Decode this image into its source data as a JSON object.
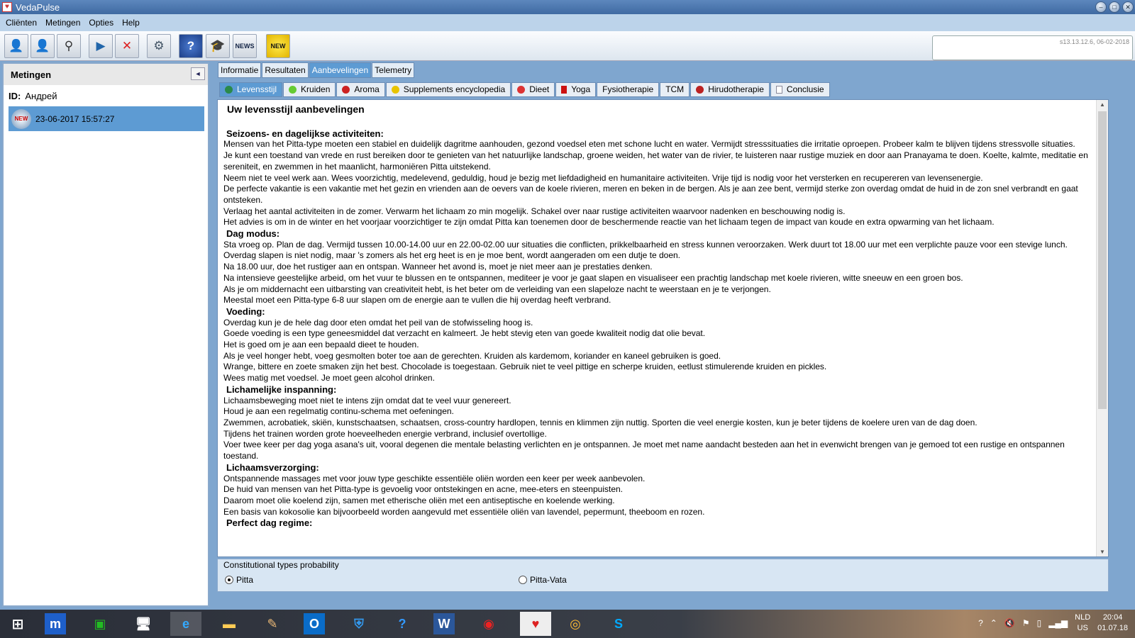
{
  "window": {
    "title": "VedaPulse"
  },
  "menu": [
    "Cliënten",
    "Metingen",
    "Opties",
    "Help"
  ],
  "toolbar": {
    "version": "s13.13.12.6, 06-02-2018",
    "icons": [
      "add-client-icon",
      "remove-client-icon",
      "search-client-icon",
      "start-measurement-icon",
      "delete-measurement-icon",
      "settings-icon",
      "help-icon",
      "education-icon",
      "news-icon",
      "new-version-icon"
    ],
    "news_label": "NEWS",
    "new_label": "NEW"
  },
  "left_panel": {
    "title": "Metingen",
    "id_label": "ID:",
    "id_value": "Андрей",
    "new_badge": "NEW",
    "measurement": "23-06-2017 15:57:27"
  },
  "tabs": [
    "Informatie",
    "Resultaten",
    "Aanbevelingen",
    "Telemetry"
  ],
  "active_tab": "Aanbevelingen",
  "subtabs": [
    "Levensstijl",
    "Kruiden",
    "Aroma",
    "Supplements encyclopedia",
    "Dieet",
    "Yoga",
    "Fysiotherapie",
    "TCM",
    "Hirudotherapie",
    "Conclusie"
  ],
  "active_subtab": "Levensstijl",
  "content": {
    "title": "Uw levensstijl aanbevelingen",
    "sections": [
      {
        "heading": "Seizoens- en dagelijkse activiteiten:",
        "lines": [
          "Mensen van het Pitta-type moeten een stabiel en duidelijk dagritme aanhouden, gezond voedsel eten met schone lucht en water. Vermijdt stresssituaties die irritatie oproepen. Probeer kalm te blijven tijdens stressvolle situaties.",
          "Je kunt een toestand van vrede en rust bereiken door te genieten van het natuurlijke landschap, groene weiden, het water van de rivier, te luisteren naar rustige muziek en door aan Pranayama te doen. Koelte, kalmte, meditatie en sereniteit, en zwemmen in het maanlicht, harmoniëren Pitta uitstekend.",
          "Neem niet te veel werk aan. Wees voorzichtig, medelevend, geduldig, houd je bezig met liefdadigheid en humanitaire activiteiten. Vrije tijd is nodig voor het versterken en recupereren van levensenergie.",
          "De perfecte vakantie is een vakantie met het gezin en vrienden aan de oevers van de koele rivieren, meren en beken in de bergen. Als je aan zee bent, vermijd sterke zon overdag omdat de huid in de zon snel verbrandt en gaat ontsteken.",
          "Verlaag het aantal activiteiten in de zomer. Verwarm het lichaam zo min mogelijk. Schakel over naar rustige activiteiten waarvoor nadenken en beschouwing nodig is.",
          "Het advies is om in de winter en het voorjaar voorzichtiger te zijn omdat Pitta kan toenemen door de beschermende reactie van het lichaam tegen de impact van koude en extra opwarming van het lichaam."
        ]
      },
      {
        "heading": "Dag modus:",
        "lines": [
          "Sta vroeg op. Plan de dag. Vermijd tussen 10.00-14.00 uur en 22.00-02.00 uur situaties die conflicten, prikkelbaarheid en stress kunnen veroorzaken. Werk duurt tot 18.00 uur met een verplichte pauze voor een stevige lunch.",
          "Overdag slapen is niet nodig, maar 's zomers als het erg heet is en je moe bent, wordt aangeraden om een dutje te doen.",
          "Na 18.00 uur, doe het rustiger aan en ontspan. Wanneer het avond is, moet je niet meer aan je prestaties denken.",
          "Na intensieve geestelijke arbeid, om het vuur te blussen en te ontspannen, mediteer je voor je gaat slapen en visualiseer een prachtig landschap met koele rivieren, witte sneeuw en een groen bos.",
          "Als je om middernacht een uitbarsting van creativiteit hebt, is het beter om de verleiding van een slapeloze nacht te weerstaan en je te verjongen.",
          "Meestal moet een Pitta-type 6-8 uur slapen om de energie aan te vullen die hij overdag heeft verbrand."
        ]
      },
      {
        "heading": "Voeding:",
        "lines": [
          "Overdag kun je de hele dag door eten omdat het peil van de stofwisseling hoog is.",
          "Goede voeding is een type geneesmiddel dat verzacht en kalmeert. Je hebt stevig eten van goede kwaliteit nodig dat olie bevat.",
          "Het is goed om je aan een bepaald dieet te houden.",
          "Als je veel honger hebt, voeg gesmolten boter toe aan de gerechten. Kruiden als kardemom, koriander en kaneel gebruiken is goed.",
          "Wrange, bittere en zoete smaken zijn het best. Chocolade is toegestaan. Gebruik niet te veel pittige en scherpe kruiden, eetlust stimulerende kruiden en pickles.",
          "Wees matig met voedsel. Je moet geen alcohol drinken."
        ]
      },
      {
        "heading": "Lichamelijke inspanning:",
        "lines": [
          "Lichaamsbeweging moet niet te intens zijn omdat dat te veel vuur genereert.",
          "Houd je aan een regelmatig continu-schema met oefeningen.",
          "Zwemmen, acrobatiek, skiën, kunstschaatsen, schaatsen, cross-country hardlopen, tennis en klimmen zijn nuttig. Sporten die veel energie kosten, kun je beter tijdens de koelere uren van de dag doen.",
          "Tijdens het trainen worden grote hoeveelheden energie verbrand, inclusief overtollige.",
          "Voer twee keer per dag yoga asana's uit, vooral degenen die mentale belasting verlichten en je ontspannen. Je moet met name aandacht besteden aan het in evenwicht brengen van je gemoed tot een rustige en ontspannen toestand."
        ]
      },
      {
        "heading": "Lichaamsverzorging:",
        "lines": [
          "Ontspannende massages met voor jouw type geschikte essentiële oliën worden een keer per week aanbevolen.",
          "De huid van mensen van het Pitta-type is gevoelig voor ontstekingen en acne, mee-eters en steenpuisten.",
          "Daarom moet olie koelend zijn, samen met etherische oliën met een antiseptische en koelende werking.",
          "Een basis van kokosolie kan bijvoorbeeld worden aangevuld met essentiële oliën van lavendel, pepermunt, theeboom en rozen."
        ]
      },
      {
        "heading": "Perfect dag regime:",
        "lines": []
      }
    ]
  },
  "constitution": {
    "label": "Constitutional types probability",
    "options": [
      "Pitta",
      "Pitta-Vata"
    ],
    "selected": "Pitta"
  },
  "taskbar": {
    "apps": [
      "windows-start-icon",
      "maxthon-icon",
      "store-icon",
      "lenovo-icon",
      "internet-explorer-icon",
      "file-explorer-icon",
      "paint-icon",
      "outlook-icon",
      "defender-icon",
      "help-icon",
      "word-icon",
      "adobe-icon",
      "vedapulse-icon",
      "chrome-icon",
      "skype-icon"
    ],
    "language": "NLD",
    "region": "US",
    "time": "20:04",
    "date": "01.07.18"
  },
  "colors": {
    "accent": "#5d9bd3",
    "titlebar": "#4673ab",
    "panel_border": "#8aa9cc"
  }
}
